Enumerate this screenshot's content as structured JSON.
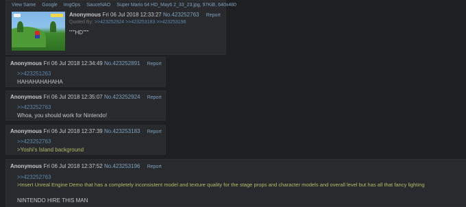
{
  "op": {
    "file_links": [
      "View Same",
      "Google",
      "ImgOps",
      "SauceNAO"
    ],
    "file_name": "Super Mario 64 HD_May6 2_33_23.jpg, 97KiB, 640x480",
    "name": "Anonymous",
    "date": "Fri 06 Jul 2018 12:33:27",
    "no": "No.423252763",
    "report": "Report",
    "quoted_by_label": "Quoted By:",
    "quoted_by": [
      ">>423252924",
      ">>423253183",
      ">>423253196"
    ],
    "text": "\"\"\"HD\"\"\"",
    "thumbnail": "super-mario-64-hd-screenshot"
  },
  "replies": [
    {
      "name": "Anonymous",
      "date": "Fri 06 Jul 2018 12:34:49",
      "no": "No.423252891",
      "report": "Report",
      "quote": ">>423251263",
      "lines": [
        {
          "text": "HAHAHAHAHAHA",
          "type": "normal"
        }
      ]
    },
    {
      "name": "Anonymous",
      "date": "Fri 06 Jul 2018 12:35:07",
      "no": "No.423252924",
      "report": "Report",
      "quote": ">>423252763",
      "lines": [
        {
          "text": "Whoa, you should work for Nintendo!",
          "type": "normal"
        }
      ]
    },
    {
      "name": "Anonymous",
      "date": "Fri 06 Jul 2018 12:37:39",
      "no": "No.423253183",
      "report": "Report",
      "quote": ">>423252763",
      "lines": [
        {
          "text": ">Yoshi's Island background",
          "type": "greentext"
        }
      ]
    },
    {
      "name": "Anonymous",
      "date": "Fri 06 Jul 2018 12:37:52",
      "no": "No.423253196",
      "report": "Report",
      "quote": ">>423252763",
      "lines": [
        {
          "text": ">Insert Unreal Engine Demo that has a completely inconsistent model and texture quality for the stage props and character models and overall level but has all that fancy lighting",
          "type": "greentext"
        },
        {
          "text": "",
          "type": "normal"
        },
        {
          "text": "NINTENDO HIRE THIS MAN",
          "type": "normal"
        }
      ]
    }
  ],
  "colors": {
    "background": "#1d1f21",
    "post_bg": "#282a2e",
    "link": "#81a2be",
    "greentext": "#b5bd68",
    "text": "#c5c8c6"
  }
}
